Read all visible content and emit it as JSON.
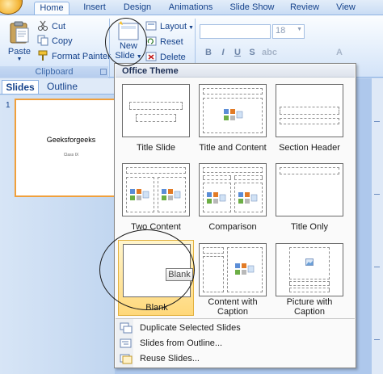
{
  "ribbon": {
    "tabs": [
      {
        "label": "Home"
      },
      {
        "label": "Insert"
      },
      {
        "label": "Design"
      },
      {
        "label": "Animations"
      },
      {
        "label": "Slide Show"
      },
      {
        "label": "Review"
      },
      {
        "label": "View"
      }
    ],
    "clipboard": {
      "paste": "Paste",
      "cut": "Cut",
      "copy": "Copy",
      "format_painter": "Format Painter",
      "group_label": "Clipboard"
    },
    "slides": {
      "new_slide_line1": "New",
      "new_slide_line2": "Slide",
      "layout": "Layout",
      "reset": "Reset",
      "delete": "Delete"
    },
    "font": {
      "size": "18",
      "bold": "B",
      "italic": "I",
      "underline": "U",
      "strike": "S"
    }
  },
  "pane": {
    "tabs": [
      {
        "label": "Slides"
      },
      {
        "label": "Outline"
      }
    ],
    "slide": {
      "number": "1",
      "title": "Geeksforgeeks",
      "subtitle": "Class IX"
    }
  },
  "gallery": {
    "header": "Office Theme",
    "layouts": [
      {
        "label": "Title Slide"
      },
      {
        "label": "Title and Content"
      },
      {
        "label": "Section Header"
      },
      {
        "label": "Two Content"
      },
      {
        "label": "Comparison"
      },
      {
        "label": "Title Only"
      },
      {
        "label": "Blank"
      },
      {
        "label": "Content with",
        "label2": "Caption"
      },
      {
        "label": "Picture with",
        "label2": "Caption"
      }
    ],
    "tooltip": "Blank",
    "menu": [
      {
        "label": "Duplicate Selected Slides"
      },
      {
        "label": "Slides from Outline..."
      },
      {
        "label": "Reuse Slides..."
      }
    ]
  },
  "colors": {
    "ribbon_text": "#15428b",
    "hover_fill": "#ffd87a",
    "selected_border": "#f0a03c"
  }
}
